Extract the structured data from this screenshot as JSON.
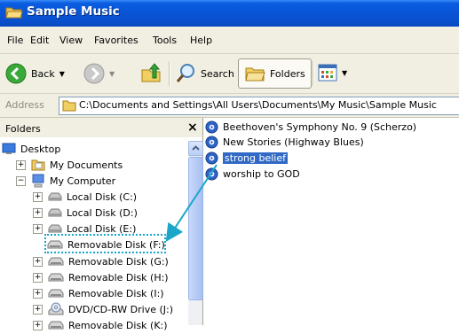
{
  "window": {
    "title": "Sample Music"
  },
  "menu": [
    "File",
    "Edit",
    "View",
    "Favorites",
    "Tools",
    "Help"
  ],
  "toolbar": {
    "back_label": "Back",
    "search_label": "Search",
    "folders_label": "Folders"
  },
  "address": {
    "label": "Address",
    "value": "C:\\Documents and Settings\\All Users\\Documents\\My Music\\Sample Music"
  },
  "folders_pane": {
    "title": "Folders",
    "close_glyph": "×",
    "items": [
      {
        "label": "Desktop"
      },
      {
        "label": "My Documents",
        "expander": "+"
      },
      {
        "label": "My Computer",
        "expander": "−"
      },
      {
        "label": "Local Disk (C:)",
        "expander": "+"
      },
      {
        "label": "Local Disk (D:)",
        "expander": "+"
      },
      {
        "label": "Local Disk (E:)",
        "expander": "+"
      },
      {
        "label": "Removable Disk (F:)"
      },
      {
        "label": "Removable Disk (G:)",
        "expander": "+"
      },
      {
        "label": "Removable Disk (H:)",
        "expander": "+"
      },
      {
        "label": "Removable Disk (I:)",
        "expander": "+"
      },
      {
        "label": "DVD/CD-RW Drive (J:)",
        "expander": "+"
      },
      {
        "label": "Removable Disk (K:)",
        "expander": "+"
      }
    ]
  },
  "files": [
    {
      "name": "Beethoven's Symphony No. 9 (Scherzo)",
      "selected": false
    },
    {
      "name": "New Stories (Highway Blues)",
      "selected": false
    },
    {
      "name": "strong belief",
      "selected": true
    },
    {
      "name": "worship to GOD",
      "selected": false
    }
  ],
  "colors": {
    "title_bar": "#0a55d5",
    "selection": "#316ac5",
    "annotation": "#1aa6c9",
    "chrome": "#f1efe2"
  }
}
